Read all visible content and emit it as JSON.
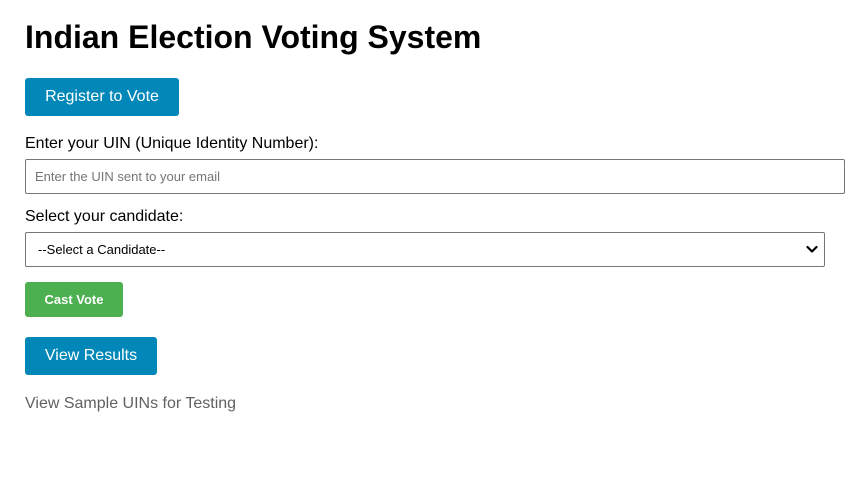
{
  "header": {
    "title": "Indian Election Voting System"
  },
  "register": {
    "label": "Register to Vote"
  },
  "uin": {
    "label": "Enter your UIN (Unique Identity Number):",
    "placeholder": "Enter the UIN sent to your email",
    "value": ""
  },
  "candidate": {
    "label": "Select your candidate:",
    "selected": "--Select a Candidate--",
    "icon": "chevron-down-icon"
  },
  "cast": {
    "label": "Cast Vote"
  },
  "results": {
    "label": "View Results"
  },
  "sample": {
    "label": "View Sample UINs for Testing"
  },
  "colors": {
    "primary_button": "#0288b8",
    "cast_button": "#4caf50",
    "link_text": "#616161"
  }
}
